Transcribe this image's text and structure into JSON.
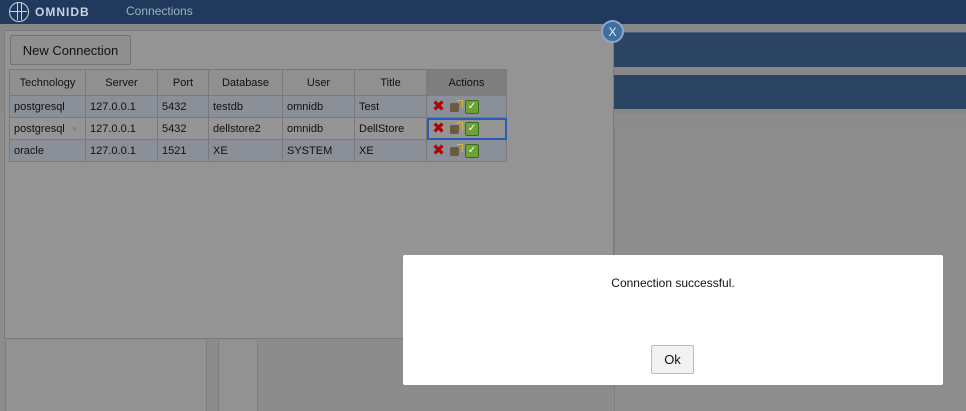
{
  "app": {
    "logo_text": "OMNIDB",
    "nav_connections": "Connections"
  },
  "connections_window": {
    "new_connection_label": "New Connection",
    "close_label": "X",
    "columns": [
      "Technology",
      "Server",
      "Port",
      "Database",
      "User",
      "Title",
      "Actions"
    ],
    "rows": [
      {
        "technology": "postgresql",
        "server": "127.0.0.1",
        "port": "5432",
        "database": "testdb",
        "user": "omnidb",
        "title": "Test"
      },
      {
        "technology": "postgresql",
        "server": "127.0.0.1",
        "port": "5432",
        "database": "dellstore2",
        "user": "omnidb",
        "title": "DellStore"
      },
      {
        "technology": "oracle",
        "server": "127.0.0.1",
        "port": "1521",
        "database": "XE",
        "user": "SYSTEM",
        "title": "XE"
      }
    ],
    "action_icons": [
      "delete-icon",
      "connect-plug-icon",
      "test-connection-check-icon"
    ]
  },
  "dialog": {
    "message": "Connection successful.",
    "ok_label": "Ok"
  },
  "colors": {
    "topbar": "#1f3a5c",
    "close_button": "#3f6fa0",
    "delete_icon": "#b30000",
    "check_icon": "#6fa33a",
    "selected_outline": "#2b5bb5"
  }
}
